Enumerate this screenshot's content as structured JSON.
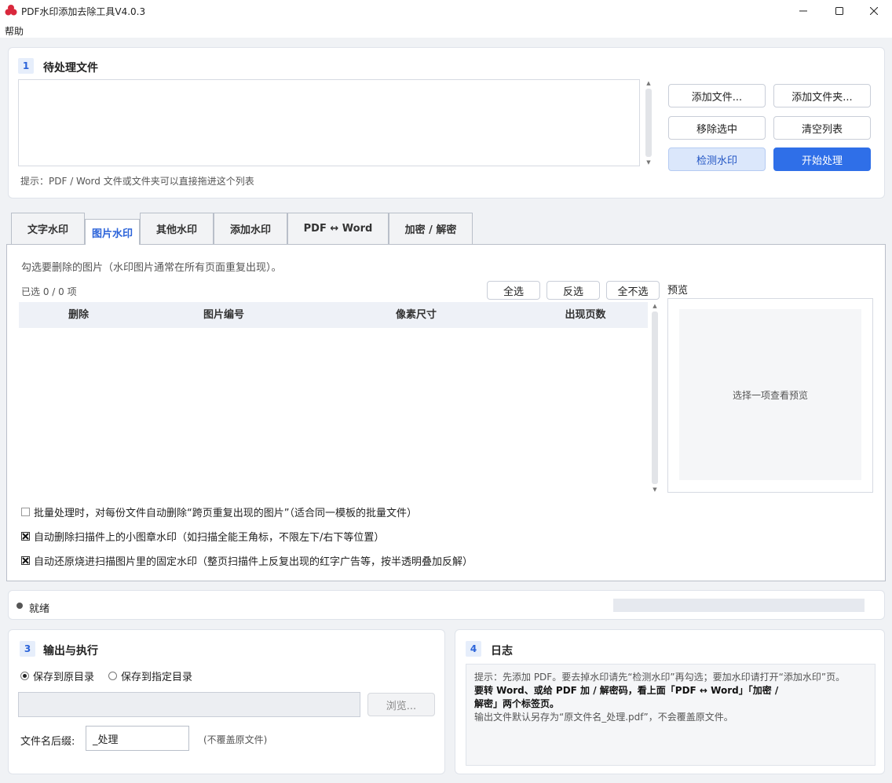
{
  "window": {
    "title": "PDF水印添加去除工具V4.0.3",
    "icon": "app-logo-icon"
  },
  "menu": {
    "help": "帮助"
  },
  "section1": {
    "number": "1",
    "title": "待处理文件",
    "hint": "提示：PDF / Word 文件或文件夹可以直接拖进这个列表",
    "buttons": {
      "add_file": "添加文件...",
      "add_folder": "添加文件夹...",
      "remove_selected": "移除选中",
      "clear_list": "清空列表",
      "detect_watermark": "检测水印",
      "start": "开始处理"
    }
  },
  "tabs": [
    "文字水印",
    "图片水印",
    "其他水印",
    "添加水印",
    "PDF ↔ Word",
    "加密 / 解密"
  ],
  "active_tab": "图片水印",
  "image_tab": {
    "description": "勾选要删除的图片（水印图片通常在所有页面重复出现）。",
    "selected_count": "已选 0 / 0 项",
    "select_all": "全选",
    "invert": "反选",
    "select_none": "全不选",
    "preview_label": "预览",
    "preview_placeholder": "选择一项查看预览",
    "columns": [
      "删除",
      "图片编号",
      "像素尺寸",
      "出现页数"
    ],
    "options": [
      {
        "label": "批量处理时，对每份文件自动删除“跨页重复出现的图片”（适合同一模板的批量文件）",
        "checked": false
      },
      {
        "label": "自动删除扫描件上的小图章水印（如扫描全能王角标，不限左下/右下等位置）",
        "checked": true
      },
      {
        "label": "自动还原烧进扫描图片里的固定水印（整页扫描件上反复出现的红字广告等，按半透明叠加反解）",
        "checked": true
      }
    ]
  },
  "status": {
    "text": "就绪",
    "progress": 0
  },
  "section3": {
    "number": "3",
    "title": "输出与执行",
    "save_original": "保存到原目录",
    "save_custom": "保存到指定目录",
    "selected_option": "保存到原目录",
    "dir_value": "",
    "browse": "浏览...",
    "suffix_label": "文件名后缀:",
    "suffix_value": "_处理",
    "suffix_note": "(不覆盖原文件)"
  },
  "section4": {
    "number": "4",
    "title": "日志",
    "log_line1": "提示：先添加 PDF。要去掉水印请先“检测水印”再勾选；要加水印请打开“添加水印”页。",
    "log_line2": "要转 Word、或给 PDF 加 / 解密码，看上面「PDF ↔ Word」「加密 /",
    "log_line3": "解密」两个标签页。",
    "log_line4": "输出文件默认另存为“原文件名_处理.pdf”，不会覆盖原文件。"
  }
}
